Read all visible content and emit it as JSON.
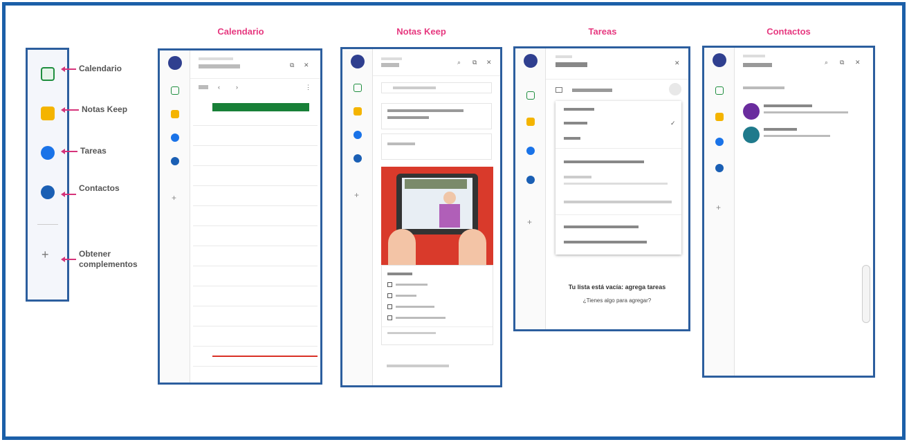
{
  "rail": {
    "items": [
      {
        "label": "Calendario",
        "color": "#1e8e3e"
      },
      {
        "label": "Notas Keep",
        "color": "#f4b400"
      },
      {
        "label": "Tareas",
        "color": "#1a73e8"
      },
      {
        "label": "Contactos",
        "color": "#1a5fb4"
      }
    ],
    "addon_line1": "Obtener",
    "addon_line2": "complementos"
  },
  "titles": {
    "calendar": "Calendario",
    "keep": "Notas Keep",
    "tasks": "Tareas",
    "contacts": "Contactos"
  },
  "tasks_panel": {
    "empty_line1": "Tu lista está vacía: agrega tareas",
    "empty_line2": "¿Tienes algo para agregar?"
  },
  "colors": {
    "frame": "#1b5fa8",
    "panel_border": "#2c5e9e",
    "title": "#e6387f",
    "calendar_event": "#188038",
    "keep_image_bg": "#d93a2b"
  }
}
